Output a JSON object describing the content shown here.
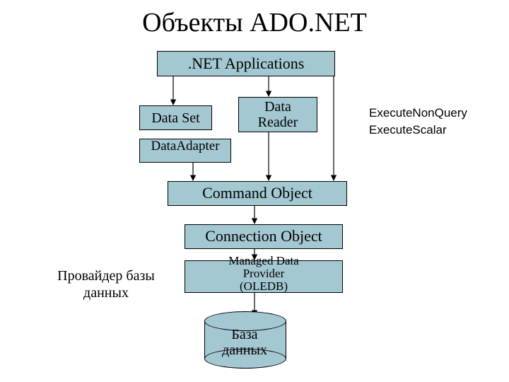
{
  "title": "Объекты ADO.NET",
  "boxes": {
    "apps": ".NET Applications",
    "dataset": "Data Set",
    "datareader": "Data\nReader",
    "dataadapter": "DataAdapter",
    "command": "Command Object",
    "connection": "Connection Object",
    "provider": "Managed Data\nProvider\n(OLEDB)",
    "database": "База\nданных"
  },
  "annotations": {
    "exec_nonquery": "ExecuteNonQuery",
    "exec_scalar": "ExecuteScalar",
    "provider_note": "Провайдер базы\nданных"
  }
}
